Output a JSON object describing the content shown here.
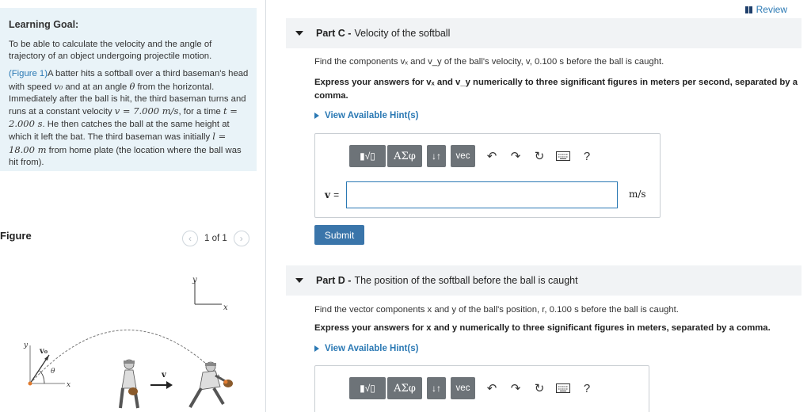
{
  "learning_goal": {
    "title": "Learning Goal:",
    "text": "To be able to calculate the velocity and the angle of trajectory of an object undergoing projectile motion.",
    "figure_link": "(Figure 1)",
    "p2_a": "A batter hits a softball over a third baseman's head with speed ",
    "v0": "v₀",
    "p2_b": " and at an angle ",
    "theta": "θ",
    "p2_c": " from the horizontal. Immediately after the ball is hit, the third baseman turns and runs at a constant velocity ",
    "v_eq": "v = 7.000 m/s",
    "p2_d": ", for a time ",
    "t_eq": "t = 2.000 s",
    "p2_e": ". He then catches the ball at the same height at which it left the bat. The third baseman was initially ",
    "l_eq": "l = 18.00 m",
    "p2_f": " from home plate (the location where the ball was hit from)."
  },
  "figure": {
    "label": "Figure",
    "page": "1 of 1",
    "axis_x": "x",
    "axis_y": "y",
    "v0_label": "v₀",
    "theta_label": "θ",
    "v_label": "v"
  },
  "review": {
    "label": "Review"
  },
  "part_c": {
    "name": "Part C -",
    "title": "Velocity of the softball",
    "question": "Find the components vₓ and v_y of the ball's velocity, v, 0.100 s before the ball is caught.",
    "instruction": "Express your answers for vₓ and v_y numerically to three significant figures in meters per second, separated by a comma.",
    "hint": "View Available Hint(s)",
    "toolbar": {
      "templates": "▮√▯",
      "greek": "ΑΣφ",
      "arrows": "↓↑",
      "vec": "vec",
      "help": "?"
    },
    "answer_label": "v",
    "answer_equals": "=",
    "answer_value": "",
    "unit": "m/s",
    "submit": "Submit"
  },
  "part_d": {
    "name": "Part D -",
    "title": "The position of the softball before the ball is caught",
    "question": "Find the vector components x and y of the ball's position, r, 0.100 s before the ball is caught.",
    "instruction": "Express your answers for x and y numerically to three significant figures in meters, separated by a comma.",
    "hint": "View Available Hint(s)",
    "toolbar": {
      "templates": "▮√▯",
      "greek": "ΑΣφ",
      "arrows": "↓↑",
      "vec": "vec",
      "help": "?"
    }
  }
}
